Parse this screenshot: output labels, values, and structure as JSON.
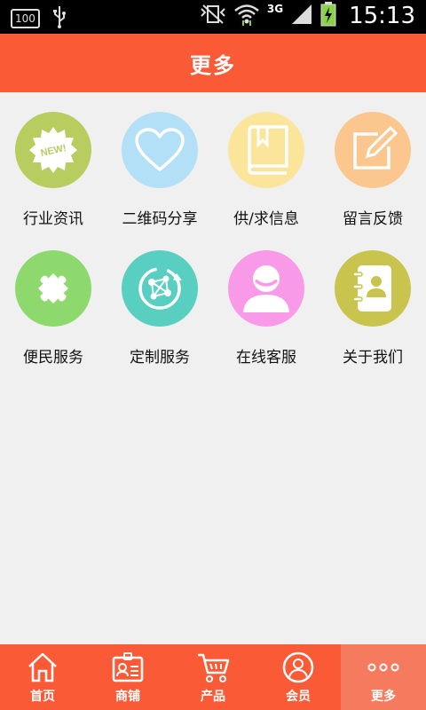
{
  "status_bar": {
    "battery_badge": "100",
    "network": "3G",
    "time": "15:13"
  },
  "header": {
    "title": "更多"
  },
  "grid": {
    "items": [
      {
        "label": "行业资讯",
        "icon": "new-badge-icon",
        "color": "#b7cd5f",
        "badge_text": "NEW!"
      },
      {
        "label": "二维码分享",
        "icon": "heart-icon",
        "color": "#b4e0f7"
      },
      {
        "label": "供/求信息",
        "icon": "book-icon",
        "color": "#fbe59b"
      },
      {
        "label": "留言反馈",
        "icon": "edit-note-icon",
        "color": "#fbc78f"
      },
      {
        "label": "便民服务",
        "icon": "puzzle-icon",
        "color": "#8ed96d"
      },
      {
        "label": "定制服务",
        "icon": "network-icon",
        "color": "#58cfc0"
      },
      {
        "label": "在线客服",
        "icon": "user-icon",
        "color": "#f99ae8"
      },
      {
        "label": "关于我们",
        "icon": "contacts-icon",
        "color": "#c9c44d"
      }
    ]
  },
  "tabbar": {
    "tabs": [
      {
        "label": "首页",
        "icon": "home-icon"
      },
      {
        "label": "商铺",
        "icon": "id-card-icon"
      },
      {
        "label": "产品",
        "icon": "cart-icon"
      },
      {
        "label": "会员",
        "icon": "member-icon"
      },
      {
        "label": "更多",
        "icon": "more-dots-icon",
        "active": true
      }
    ]
  },
  "colors": {
    "accent": "#fa5a36",
    "active_tab": "#f57a5e",
    "background": "#f0f0f0"
  }
}
